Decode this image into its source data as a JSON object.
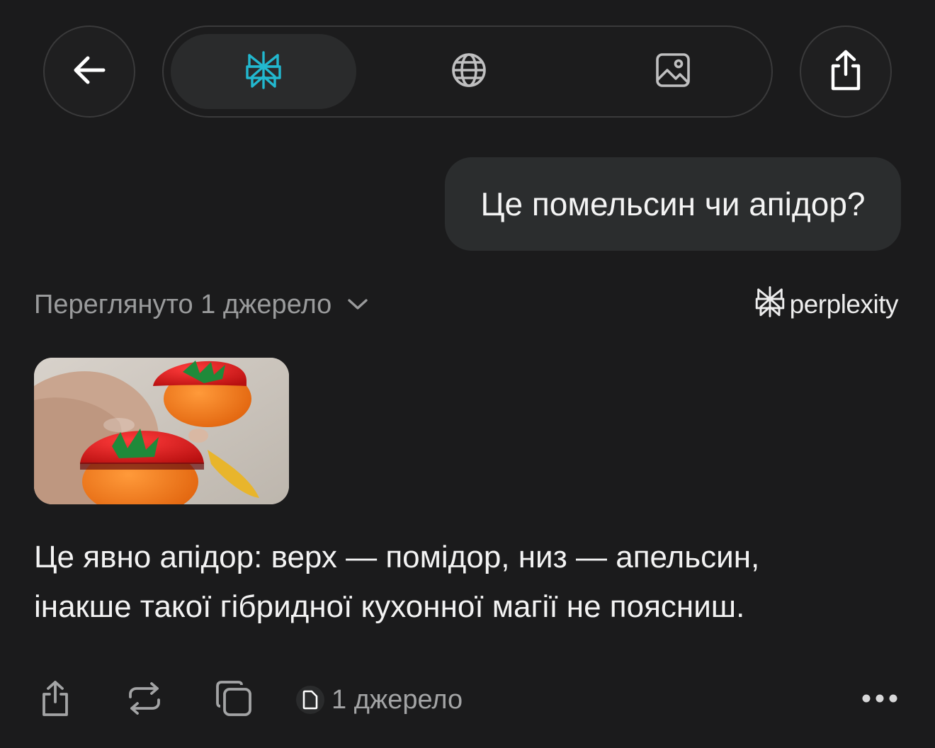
{
  "topbar": {
    "back_icon": "arrow-left-icon",
    "modes": [
      {
        "icon": "perplexity-logo-icon",
        "active": true,
        "color": "#22b8cf"
      },
      {
        "icon": "globe-icon",
        "active": false
      },
      {
        "icon": "image-icon",
        "active": false
      }
    ],
    "share_icon": "share-icon"
  },
  "user_message": "Це помельсин чи апідор?",
  "sources_summary": {
    "label": "Переглянуто 1 джерело",
    "chevron_icon": "chevron-down-icon"
  },
  "brand": {
    "name": "perplexity",
    "icon": "perplexity-logo-icon"
  },
  "thumbnail": {
    "icon": "photo-thumbnail"
  },
  "answer": {
    "line1": "Це явно апідор: верх — помідор, низ — апельсин,",
    "line2": "інакше такої гібридної кухонної магії не поясниш."
  },
  "actions": {
    "share_icon": "share-icon",
    "repeat_icon": "repeat-icon",
    "copy_icon": "copy-icon",
    "sources_label": "1 джерело",
    "sources_icon": "document-icon",
    "more_icon": "more-horizontal-icon"
  },
  "colors": {
    "background": "#1b1b1c",
    "bubble": "#2b2d2e",
    "accent": "#22b8cf",
    "muted_text": "#9a9b9c"
  }
}
